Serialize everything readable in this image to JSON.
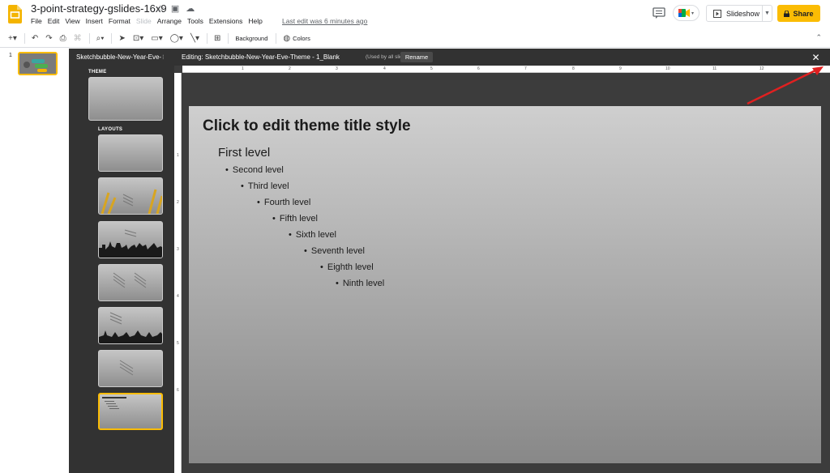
{
  "header": {
    "doc_title": "3-point-strategy-gslides-16x9",
    "menu": [
      "File",
      "Edit",
      "View",
      "Insert",
      "Format",
      "Slide",
      "Arrange",
      "Tools",
      "Extensions",
      "Help"
    ],
    "disabled_menu": "Slide",
    "last_edit": "Last edit was 6 minutes ago",
    "slideshow_label": "Slideshow",
    "share_label": "Share"
  },
  "toolbar": {
    "background_label": "Background",
    "colors_label": "Colors"
  },
  "filmstrip": {
    "slide_number": "1"
  },
  "theme_panel": {
    "theme_name": "Sketchbubble-New-Year-Eve-",
    "theme_label": "THEME",
    "layouts_label": "LAYOUTS"
  },
  "editor": {
    "editing_title": "Editing: Sketchbubble-New-Year-Eve-Theme - 1_Blank",
    "used_by": "(Used by all slides)",
    "rename_label": "Rename",
    "ruler_h": [
      "1",
      "2",
      "3",
      "4",
      "5",
      "6",
      "7",
      "8",
      "9",
      "10",
      "11",
      "12"
    ],
    "ruler_v": [
      "1",
      "2",
      "3",
      "4",
      "5",
      "6"
    ]
  },
  "slide": {
    "title": "Click to edit theme title style",
    "levels": [
      "First level",
      "Second level",
      "Third level",
      "Fourth level",
      "Fifth level",
      "Sixth level",
      "Seventh level",
      "Eighth level",
      "Ninth level"
    ]
  },
  "colors": {
    "accent_yellow": "#fbbc04",
    "panel_dark": "#323232",
    "annotation_arrow": "#e02020"
  }
}
